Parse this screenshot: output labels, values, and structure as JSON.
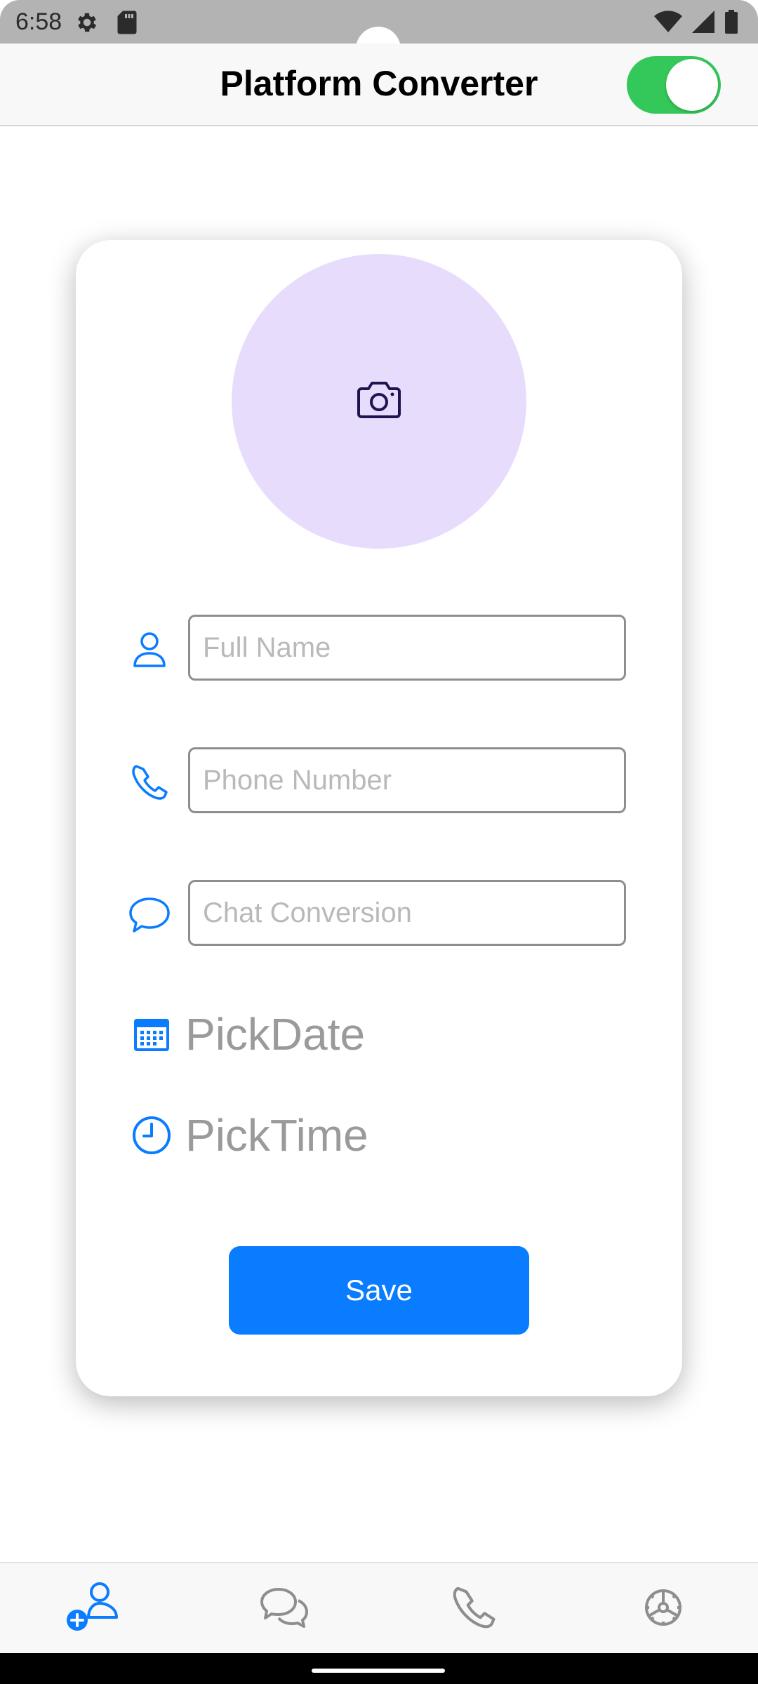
{
  "status_bar": {
    "time": "6:58",
    "icons": [
      "settings-gear-icon",
      "sd-card-icon",
      "wifi-icon",
      "cell-signal-icon",
      "battery-icon"
    ]
  },
  "header": {
    "title": "Platform Converter",
    "toggle_on": true,
    "toggle_color": "#34c759"
  },
  "form": {
    "avatar_color": "#e8dcfd",
    "avatar_icon": "camera-icon",
    "fields": [
      {
        "icon": "person-icon",
        "placeholder": "Full Name",
        "value": ""
      },
      {
        "icon": "phone-icon",
        "placeholder": "Phone Number",
        "value": ""
      },
      {
        "icon": "chat-bubble-icon",
        "placeholder": "Chat Conversion",
        "value": ""
      }
    ],
    "pick_date_label": "PickDate",
    "pick_time_label": "PickTime",
    "save_label": "Save",
    "accent_color": "#0a7cff"
  },
  "bottom_nav": {
    "items": [
      {
        "icon": "add-person-icon",
        "active": true
      },
      {
        "icon": "chats-icon",
        "active": false
      },
      {
        "icon": "phone-icon",
        "active": false
      },
      {
        "icon": "settings-icon",
        "active": false
      }
    ]
  }
}
